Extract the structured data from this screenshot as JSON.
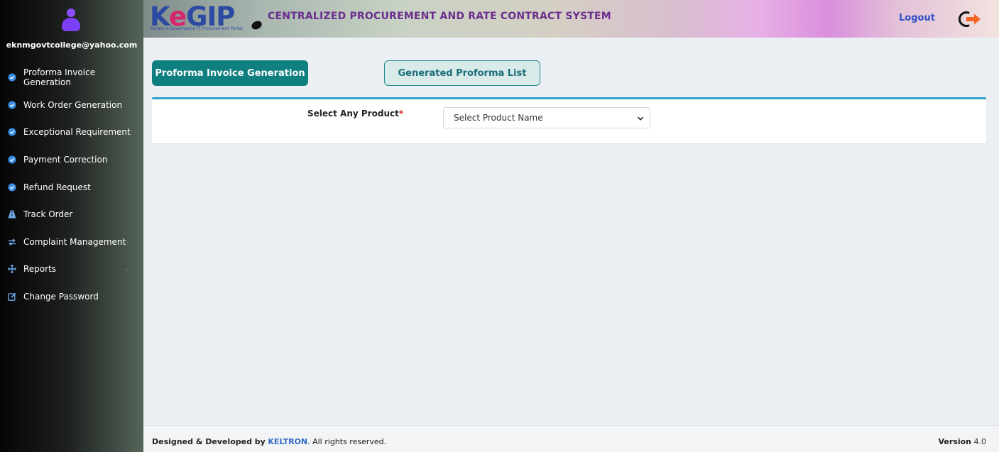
{
  "user": {
    "email": "eknmgovtcollege@yahoo.com"
  },
  "sidebar": {
    "items": [
      {
        "label": "Proforma Invoice Generation",
        "icon": "check-circle-icon"
      },
      {
        "label": "Work Order Generation",
        "icon": "check-circle-icon"
      },
      {
        "label": "Exceptional Requirement",
        "icon": "check-circle-icon"
      },
      {
        "label": "Payment Correction",
        "icon": "check-circle-icon"
      },
      {
        "label": "Refund Request",
        "icon": "check-circle-icon"
      },
      {
        "label": "Track Order",
        "icon": "road-icon"
      },
      {
        "label": "Complaint Management",
        "icon": "exchange-icon",
        "caret": "‹"
      },
      {
        "label": "Reports",
        "icon": "arrows-icon",
        "caret": "‹"
      },
      {
        "label": "Change Password",
        "icon": "edit-icon"
      }
    ]
  },
  "header": {
    "logo_text_k": "K",
    "logo_text_e": "e",
    "logo_text_rest": "GIP",
    "logo_subtitle": "Kerala e-Governance IT Procurement Portal",
    "system_title": "CENTRALIZED PROCUREMENT AND RATE CONTRACT SYSTEM",
    "logout_label": "Logout"
  },
  "tabs": {
    "primary_label": "Proforma Invoice Generation",
    "secondary_label": "Generated Proforma List"
  },
  "form": {
    "product_label": "Select Any Product",
    "required_mark": "*",
    "product_select_value": "Select Product Name"
  },
  "footer": {
    "designed_by": "Designed & Developed by",
    "brand": "KELTRON",
    "rights": ". All rights reserved.",
    "version_label": "Version",
    "version_number": "4.0"
  },
  "colors": {
    "accent": "#0f7f80",
    "panel_border": "#2ba2c9",
    "required": "#d9252f",
    "logout_icon": "#f26522"
  }
}
